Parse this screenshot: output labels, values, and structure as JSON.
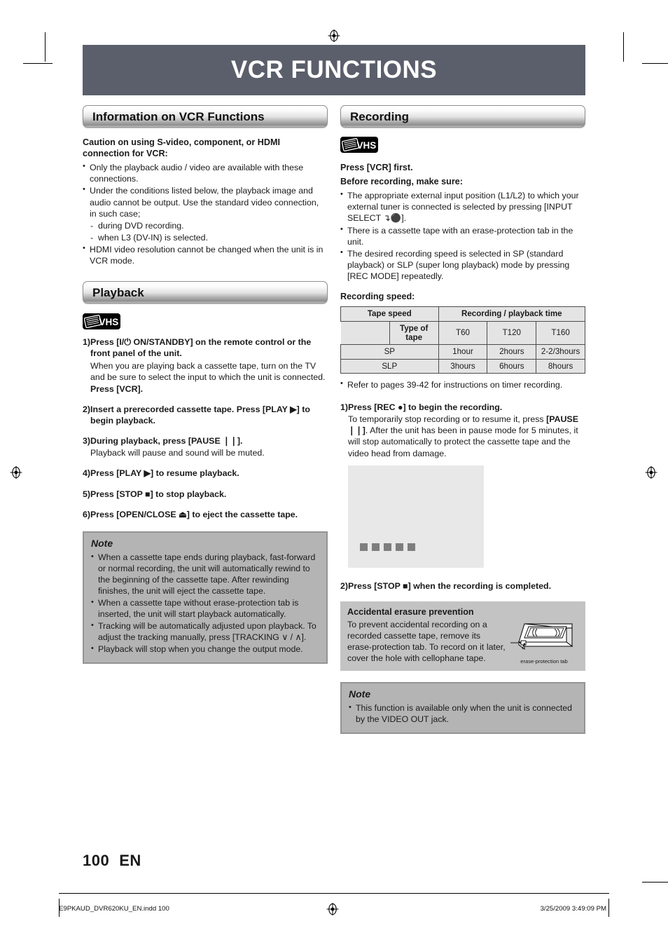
{
  "document": {
    "title": "VCR FUNCTIONS",
    "page_number": "100",
    "page_locale": "EN"
  },
  "left_column": {
    "section_title": "Information on VCR Functions",
    "caution_heading": "Caution on using S-video, component, or HDMI connection for VCR:",
    "caution_bullets": [
      "Only the playback audio / video are available with these connections.",
      "Under the conditions listed below, the playback image and audio cannot be output. Use the standard video connection, in such case;",
      "during DVD recording.",
      "when L3 (DV-IN) is selected.",
      "HDMI video resolution cannot be changed when the unit is in VCR mode."
    ],
    "playback_section_title": "Playback",
    "vhs_badge_label": "VHS",
    "playback_steps": [
      {
        "num": "1)",
        "head": "Press [I/⏻ ON/STANDBY] on the remote control or the front panel of the unit.",
        "para": "When you are playing back a cassette tape, turn on the TV and be sure to select the input to which the unit is connected.",
        "para_bold": "Press [VCR]."
      },
      {
        "num": "2)",
        "head": "Insert a prerecorded cassette tape. Press [PLAY ▶] to begin playback.",
        "para": "",
        "para_bold": ""
      },
      {
        "num": "3)",
        "head": "During playback, press [PAUSE ❘❘].",
        "para": "Playback will pause and sound will be muted.",
        "para_bold": ""
      },
      {
        "num": "4)",
        "head": "Press [PLAY ▶] to resume playback.",
        "para": "",
        "para_bold": ""
      },
      {
        "num": "5)",
        "head": "Press [STOP ■] to stop playback.",
        "para": "",
        "para_bold": ""
      },
      {
        "num": "6)",
        "head": "Press [OPEN/CLOSE ⏏] to eject the cassette tape.",
        "para": "",
        "para_bold": ""
      }
    ],
    "note_title": "Note",
    "note_bullets": [
      "When a cassette tape ends during playback, fast-forward or normal recording, the unit will automatically rewind to the beginning of the cassette tape. After rewinding finishes, the unit will eject the cassette tape.",
      "When a cassette tape without erase-protection tab is inserted, the unit will start playback automatically.",
      "Tracking will be automatically adjusted upon playback. To adjust the tracking manually, press [TRACKING ∨ / ∧].",
      "Playback will stop when you change the output mode."
    ]
  },
  "right_column": {
    "section_title": "Recording",
    "vhs_badge_label": "VHS",
    "press_vcr_first": "Press [VCR] first.",
    "before_recording_heading": "Before recording, make sure:",
    "before_recording_bullets": [
      "The appropriate external input position (L1/L2) to which your external tuner is connected is selected by pressing [INPUT SELECT ↴⚫].",
      "There is a cassette tape with an erase-protection tab in the unit.",
      "The desired recording speed is selected in SP (standard playback) or SLP (super long playback) mode by pressing [REC MODE] repeatedly."
    ],
    "recording_speed_label": "Recording speed:",
    "table": {
      "corner_label": "Tape speed",
      "span_header": "Recording / playback time",
      "row_label_header": "Type of tape",
      "tape_types": [
        "T60",
        "T120",
        "T160"
      ],
      "rows": [
        {
          "speed": "SP",
          "times": [
            "1hour",
            "2hours",
            "2-2/3hours"
          ]
        },
        {
          "speed": "SLP",
          "times": [
            "3hours",
            "6hours",
            "8hours"
          ]
        }
      ]
    },
    "refer_note": "Refer to pages 39-42 for instructions on timer recording.",
    "recording_steps": [
      {
        "num": "1)",
        "head": "Press [REC ●] to begin the recording.",
        "para_pre": "To temporarily stop recording or to resume it, press ",
        "para_bold": "[PAUSE ❘❘]",
        "para_post": ". After the unit has been in pause mode for 5 minutes, it will stop automatically to protect the cassette tape and the video head from damage."
      },
      {
        "num": "2)",
        "head": "Press [STOP ■] when the recording is completed.",
        "para_pre": "",
        "para_bold": "",
        "para_post": ""
      }
    ],
    "erase_box": {
      "title": "Accidental erasure prevention",
      "body": "To prevent accidental recording on a recorded cassette tape, remove its erase-protection tab. To record on it later, cover the hole with cellophane tape.",
      "figure_caption": "erase-protection tab"
    },
    "note_title": "Note",
    "note_bullets": [
      "This function is available only when the unit is connected by the VIDEO OUT jack."
    ]
  },
  "print_footer": {
    "file_name": "E9PKAUD_DVR620KU_EN.indd   100",
    "timestamp": "3/25/2009   3:49:09 PM"
  },
  "colors": {
    "title_bar": "#5b5f6b",
    "note_box_fill": "#b4b4b4",
    "note_box_border": "#949494",
    "erase_box_fill": "#c3c3c3",
    "table_fill": "#e4e4e4",
    "image_placeholder": "#e8e8e8"
  }
}
